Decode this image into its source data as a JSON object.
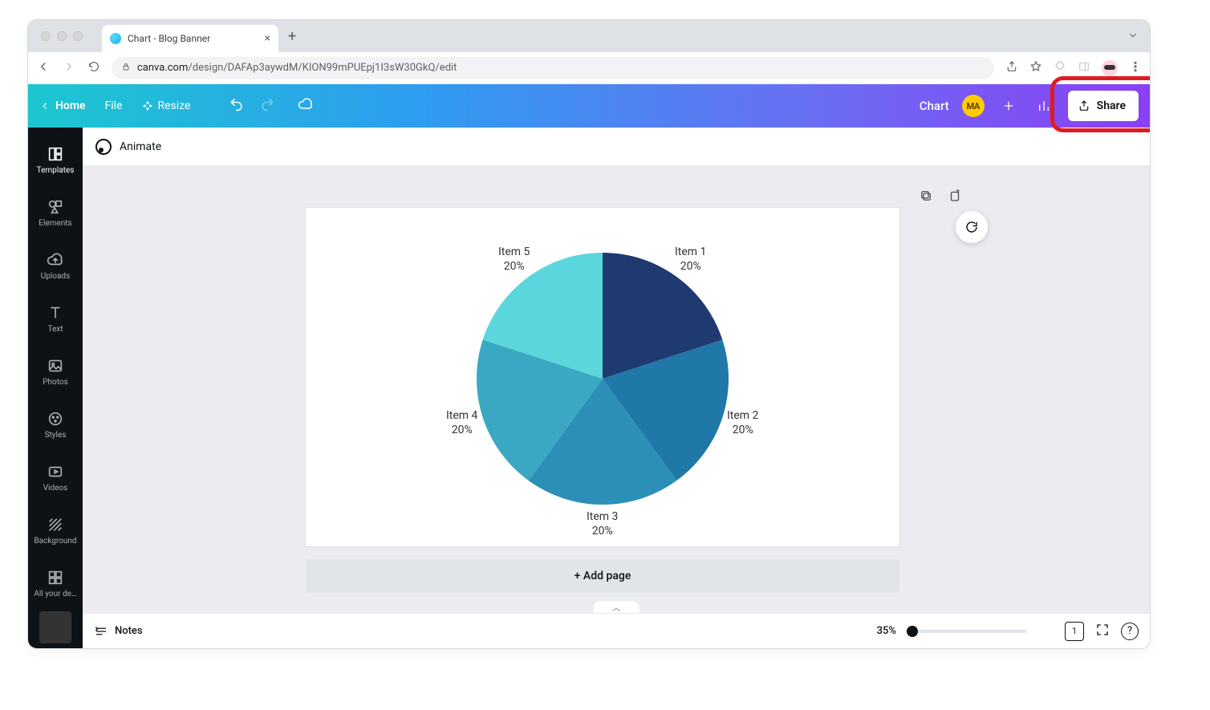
{
  "browser": {
    "tab_title": "Chart - Blog Banner",
    "url_host": "canva.com",
    "url_path": "/design/DAFAp3aywdM/KION99mPUEpj1I3sW30GkQ/edit"
  },
  "topbar": {
    "home": "Home",
    "file": "File",
    "resize": "Resize",
    "doc_title": "Chart",
    "avatar_initials": "MA",
    "share": "Share"
  },
  "context_bar": {
    "animate": "Animate"
  },
  "sidebar": {
    "items": [
      {
        "label": "Templates"
      },
      {
        "label": "Elements"
      },
      {
        "label": "Uploads"
      },
      {
        "label": "Text"
      },
      {
        "label": "Photos"
      },
      {
        "label": "Styles"
      },
      {
        "label": "Videos"
      },
      {
        "label": "Background"
      },
      {
        "label": "All your de…"
      }
    ]
  },
  "canvas": {
    "add_page": "+ Add page"
  },
  "footer": {
    "notes": "Notes",
    "zoom_label": "35%",
    "zoom_value": 35,
    "page_count": "1"
  },
  "chart_data": {
    "type": "pie",
    "title": "",
    "series": [
      {
        "name": "Item 1",
        "value": 20,
        "percent": "20%",
        "color": "#1e3a70"
      },
      {
        "name": "Item 2",
        "value": 20,
        "percent": "20%",
        "color": "#1f78a8"
      },
      {
        "name": "Item 3",
        "value": 20,
        "percent": "20%",
        "color": "#2b8fb8"
      },
      {
        "name": "Item 4",
        "value": 20,
        "percent": "20%",
        "color": "#3aa8c2"
      },
      {
        "name": "Item 5",
        "value": 20,
        "percent": "20%",
        "color": "#5bd6dc"
      }
    ]
  }
}
